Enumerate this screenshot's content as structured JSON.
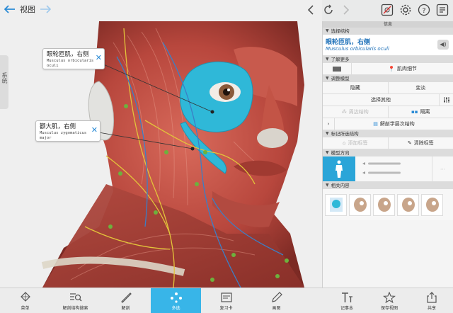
{
  "topbar": {
    "view_label": "视图"
  },
  "side_tab": {
    "label": "系统"
  },
  "callouts": [
    {
      "name": "眼轮匝肌，右侧",
      "latin": "Musculus orbicularis oculi"
    },
    {
      "name": "颧大肌，右侧",
      "latin": "Musculus zygomaticus major"
    }
  ],
  "panel": {
    "header": "信息",
    "select_structure": "选择结构",
    "selected_name": "眼轮匝肌，右侧",
    "selected_latin": "Musculus orbicularis oculi",
    "learn_more": "了解更多",
    "muscle_details": "肌肉细节",
    "adjust_model": "调整模型",
    "hide": "隐藏",
    "fade": "变淡",
    "select_other": "选择其他",
    "nearby": "周边结构",
    "isolate": "隔离",
    "anatomy_layers": "解剖学层次结构",
    "tag_structure": "标记所选结构",
    "add_tag": "添加标签",
    "clear_tags": "清除标签",
    "model_orientation": "模型方向",
    "related": "相关内容"
  },
  "toolbar": {
    "items": [
      {
        "label": "菜单",
        "icon": "grid-icon"
      },
      {
        "label": "解剖结构搜索",
        "icon": "list-search-icon"
      },
      {
        "label": "解剖",
        "icon": "scalpel-icon"
      },
      {
        "label": "多选",
        "icon": "multi-select-icon",
        "active": true
      },
      {
        "label": "复习卡",
        "icon": "card-icon"
      },
      {
        "label": "画图",
        "icon": "pencil-icon"
      }
    ],
    "right_items": [
      {
        "label": "记事本",
        "icon": "text-icon"
      },
      {
        "label": "保存视图",
        "icon": "star-icon"
      },
      {
        "label": "共享",
        "icon": "share-icon"
      }
    ]
  },
  "colors": {
    "accent": "#38b5e8",
    "selected_muscle": "#2fb8d8",
    "link_blue": "#1b6fb8",
    "muscle_red": "#b8473d"
  }
}
